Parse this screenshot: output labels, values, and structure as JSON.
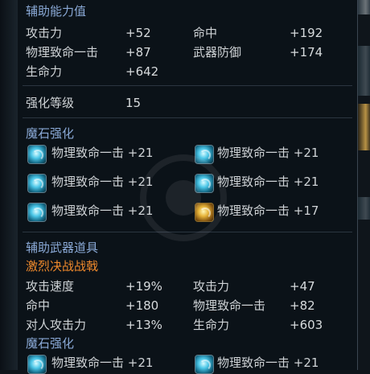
{
  "auxiliary_stats": {
    "title": "辅助能力值",
    "rows": [
      {
        "left_label": "攻击力",
        "left_value": "+52",
        "right_label": "命中",
        "right_value": "+192"
      },
      {
        "left_label": "物理致命一击",
        "left_value": "+87",
        "right_label": "武器防御",
        "right_value": "+174"
      },
      {
        "left_label": "生命力",
        "left_value": "+642",
        "right_label": "",
        "right_value": ""
      }
    ]
  },
  "enhance": {
    "label": "强化等级",
    "value": "15"
  },
  "manastone": {
    "title": "魔石强化",
    "slots": [
      {
        "label": "物理致命一击 +21",
        "icon": "blue-manastone-icon"
      },
      {
        "label": "物理致命一击 +21",
        "icon": "blue-manastone-icon"
      },
      {
        "label": "物理致命一击 +21",
        "icon": "blue-manastone-icon"
      },
      {
        "label": "物理致命一击 +21",
        "icon": "blue-manastone-icon"
      },
      {
        "label": "物理致命一击 +21",
        "icon": "blue-manastone-icon"
      },
      {
        "label": "物理致命一击 +17",
        "icon": "gold-manastone-icon"
      }
    ]
  },
  "aux_weapon": {
    "title": "辅助武器道具",
    "name": "激烈决战战戟",
    "name_color": "#f08a2c",
    "rows": [
      {
        "left_label": "攻击速度",
        "left_value": "+19%",
        "right_label": "攻击力",
        "right_value": "+47"
      },
      {
        "left_label": "命中",
        "left_value": "+180",
        "right_label": "物理致命一击",
        "right_value": "+82"
      },
      {
        "left_label": "对人攻击力",
        "left_value": "+13%",
        "right_label": "生命力",
        "right_value": "+603"
      }
    ],
    "manastone_title": "魔石强化",
    "manastone_slots": [
      {
        "label": "物理致命一击 +21",
        "icon": "blue-manastone-icon"
      },
      {
        "label": "物理致命一击 +21",
        "icon": "blue-manastone-icon"
      }
    ]
  },
  "colors": {
    "title": "#8aa9d6",
    "text": "#cfd3d6",
    "item_name": "#f08a2c",
    "background": "#0b1218"
  }
}
